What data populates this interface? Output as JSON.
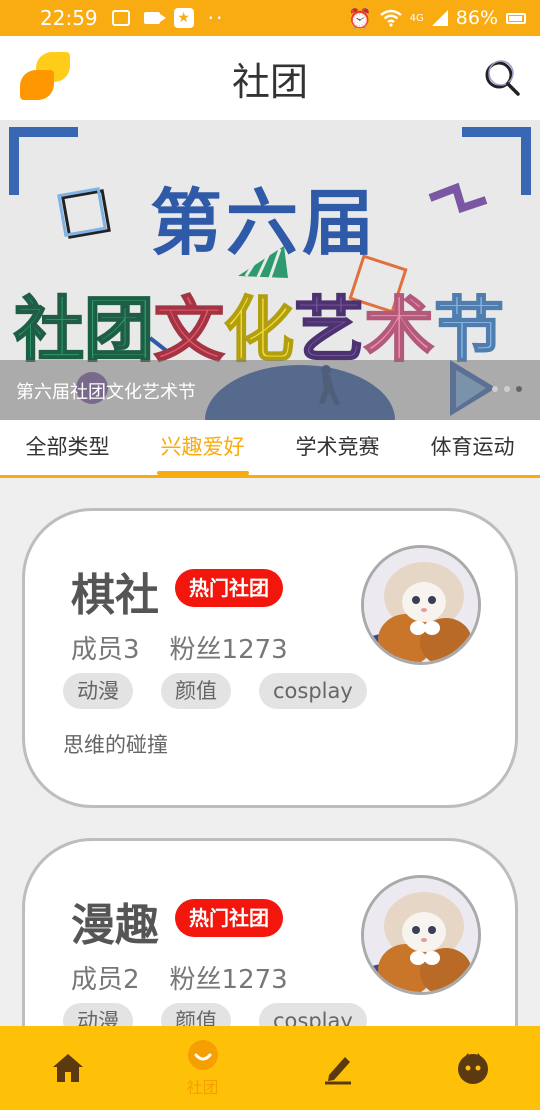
{
  "status_bar": {
    "time": "22:59",
    "dots": "··",
    "battery": "86%",
    "network": "4G"
  },
  "header": {
    "title": "社团"
  },
  "banner": {
    "line1": "第六届",
    "line2": [
      "社",
      "团",
      "文",
      "化",
      "艺",
      "术",
      "节"
    ],
    "caption": "第六届社团文化艺术节",
    "page_count": 3,
    "active_index": 2
  },
  "tabs": [
    {
      "label": "全部类型",
      "active": false
    },
    {
      "label": "兴趣爱好",
      "active": true
    },
    {
      "label": "学术竞赛",
      "active": false
    },
    {
      "label": "体育运动",
      "active": false
    }
  ],
  "cards": [
    {
      "name": "棋社",
      "badge": "热门社团",
      "members": "成员3",
      "fans": "粉丝1273",
      "tags": [
        "动漫",
        "颜值",
        "cosplay"
      ],
      "desc": "思维的碰撞"
    },
    {
      "name": "漫趣",
      "badge": "热门社团",
      "members": "成员2",
      "fans": "粉丝1273",
      "tags": [
        "动漫",
        "颜值",
        "cosplay"
      ],
      "desc": ""
    }
  ],
  "bottom_nav": [
    {
      "icon": "home-icon",
      "label": "",
      "active": false
    },
    {
      "icon": "smile-icon",
      "label": "社团",
      "active": true
    },
    {
      "icon": "pen-icon",
      "label": "",
      "active": false
    },
    {
      "icon": "face-icon",
      "label": "",
      "active": false
    }
  ],
  "colors": {
    "accent": "#f9ab12",
    "nav_bg": "#ffc107",
    "badge": "#f2160c"
  }
}
